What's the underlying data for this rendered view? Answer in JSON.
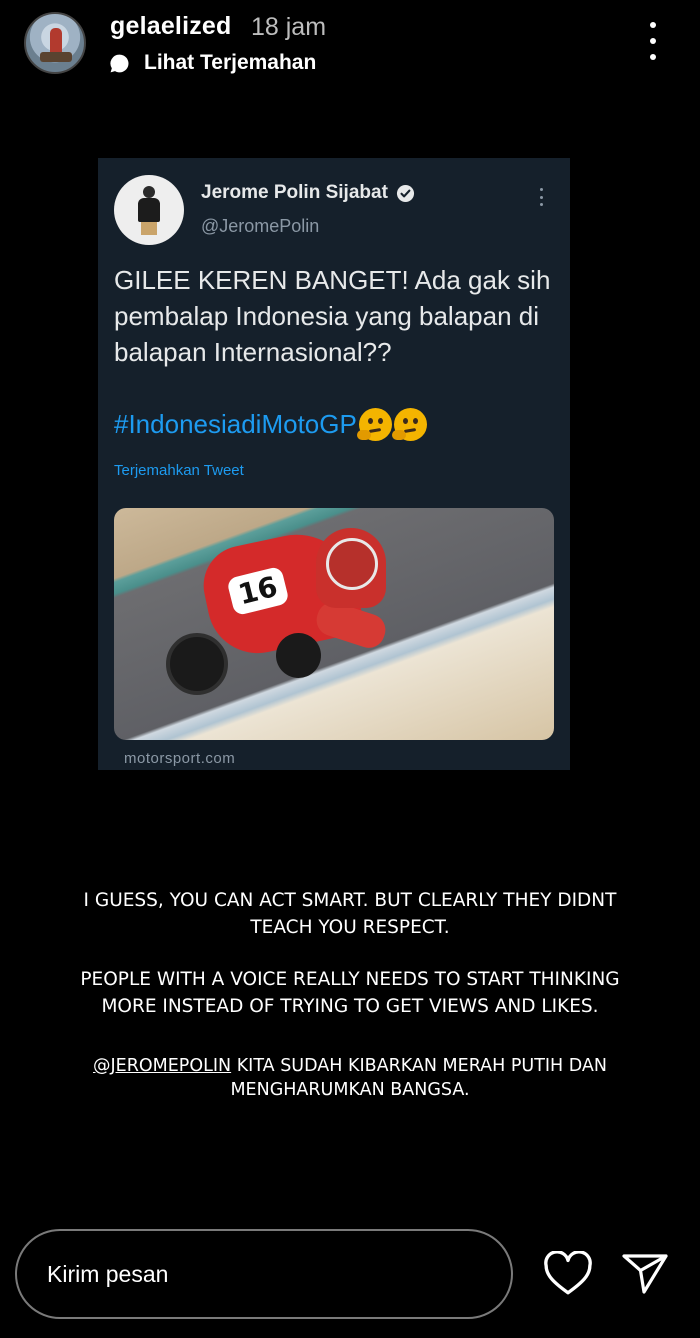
{
  "header": {
    "username": "gelaelized",
    "time": "18 jam",
    "translate_label": "Lihat Terjemahan"
  },
  "tweet": {
    "author_name": "Jerome Polin Sijabat",
    "handle": "@JeromePolin",
    "text": "GILEE KEREN BANGET! Ada gak sih pembalap Indonesia yang balapan di balapan Internasional??",
    "hashtag": "#IndonesiadiMotoGP",
    "emoji": [
      "thinking-face",
      "thinking-face"
    ],
    "translate_label": "Terjemahkan Tweet",
    "image_number": "16",
    "link_domain": "motorsport.com",
    "colors": {
      "background": "#15202b",
      "link": "#1d9bf0",
      "muted": "#8b98a5"
    }
  },
  "caption": {
    "paragraph1": "I GUESS, YOU CAN ACT SMART. BUT CLEARLY THEY DIDNT TEACH YOU RESPECT.",
    "paragraph2": "PEOPLE WITH A VOICE REALLY NEEDS TO START THINKING MORE INSTEAD OF TRYING TO GET VIEWS AND LIKES.",
    "mention": "@JEROMEPOLIN",
    "paragraph3_rest": " KITA SUDAH KIBARKAN MERAH PUTIH DAN MENGHARUMKAN BANGSA."
  },
  "footer": {
    "message_placeholder": "Kirim pesan",
    "like_icon": "heart-icon",
    "send_icon": "send-icon"
  }
}
